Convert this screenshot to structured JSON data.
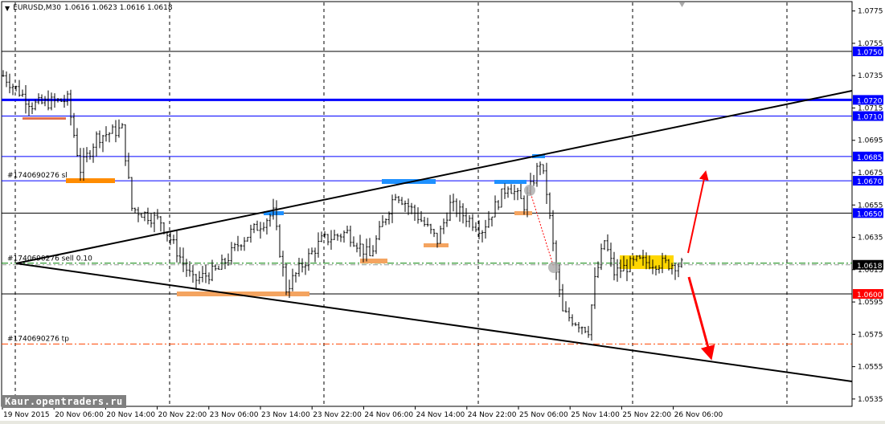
{
  "header": {
    "symbol": "EURUSD,M30",
    "ohlc": "1.0616 1.0623 1.0616 1.0618",
    "menu_icon": "triangle-down-icon"
  },
  "watermark": "Kaur.opentraders.ru",
  "order_labels": {
    "sl": "#1740690276 sl",
    "entry": "#1740690276 sell 0.10",
    "tp": "#1740690276 tp"
  },
  "chart_data": {
    "type": "candlestick",
    "symbol": "EURUSD",
    "timeframe": "M30",
    "ylim": [
      1.053,
      1.078
    ],
    "y_ticks": [
      "1.0775",
      "1.0755",
      "1.0735",
      "1.0715",
      "1.0695",
      "1.0675",
      "1.0655",
      "1.0635",
      "1.0615",
      "1.0595",
      "1.0575",
      "1.0555",
      "1.0535"
    ],
    "x_ticks": [
      "19 Nov 2015",
      "20 Nov 06:00",
      "20 Nov 14:00",
      "20 Nov 22:00",
      "23 Nov 06:00",
      "23 Nov 14:00",
      "23 Nov 22:00",
      "24 Nov 06:00",
      "24 Nov 14:00",
      "24 Nov 22:00",
      "25 Nov 06:00",
      "25 Nov 14:00",
      "25 Nov 22:00",
      "26 Nov 06:00"
    ],
    "price_path": [
      [
        0,
        1.0735
      ],
      [
        9,
        1.0717
      ],
      [
        20,
        1.072
      ],
      [
        24,
        1.0677
      ],
      [
        29,
        1.0697
      ],
      [
        37,
        1.0702
      ],
      [
        40,
        1.0653
      ],
      [
        49,
        1.0645
      ],
      [
        59,
        1.0608
      ],
      [
        67,
        1.0615
      ],
      [
        74,
        1.0633
      ],
      [
        84,
        1.065
      ],
      [
        88,
        1.0603
      ],
      [
        93,
        1.0618
      ],
      [
        99,
        1.0633
      ],
      [
        107,
        1.0638
      ],
      [
        114,
        1.0623
      ],
      [
        122,
        1.0663
      ],
      [
        129,
        1.0648
      ],
      [
        135,
        1.0633
      ],
      [
        139,
        1.0655
      ],
      [
        149,
        1.064
      ],
      [
        157,
        1.0668
      ],
      [
        162,
        1.0655
      ],
      [
        167,
        1.0682
      ],
      [
        169,
        1.0663
      ],
      [
        172,
        1.0613
      ],
      [
        174,
        1.0588
      ],
      [
        182,
        1.0578
      ],
      [
        184,
        1.0608
      ],
      [
        187,
        1.0633
      ],
      [
        190,
        1.0613
      ],
      [
        197,
        1.062
      ],
      [
        211,
        1.0618
      ]
    ],
    "levels": [
      {
        "price": 1.075,
        "label": "1.0750",
        "color": "#000000",
        "tag": "#0000ff"
      },
      {
        "price": 1.072,
        "label": "1.0720",
        "color": "#0000ff",
        "tag": "#0000ff",
        "thick": true
      },
      {
        "price": 1.071,
        "label": "1.0710",
        "color": "#0000ff",
        "tag": "#0000ff"
      },
      {
        "price": 1.0685,
        "label": "1.0685",
        "color": "#0000ff",
        "tag": "#0000ff"
      },
      {
        "price": 1.067,
        "label": "1.0670",
        "color": "#0000ff",
        "tag": "#0000ff"
      },
      {
        "price": 1.065,
        "label": "1.0650",
        "color": "#000000",
        "tag": "#0000ff"
      },
      {
        "price": 1.06,
        "label": "1.0600",
        "color": "#000000",
        "tag": "#ff0000"
      }
    ],
    "current_price": {
      "price": 1.0618,
      "label": "1.0618",
      "tag": "#000000"
    },
    "sell_price": 1.0619,
    "tp_price": 1.0569,
    "sl_price": 1.067
  }
}
